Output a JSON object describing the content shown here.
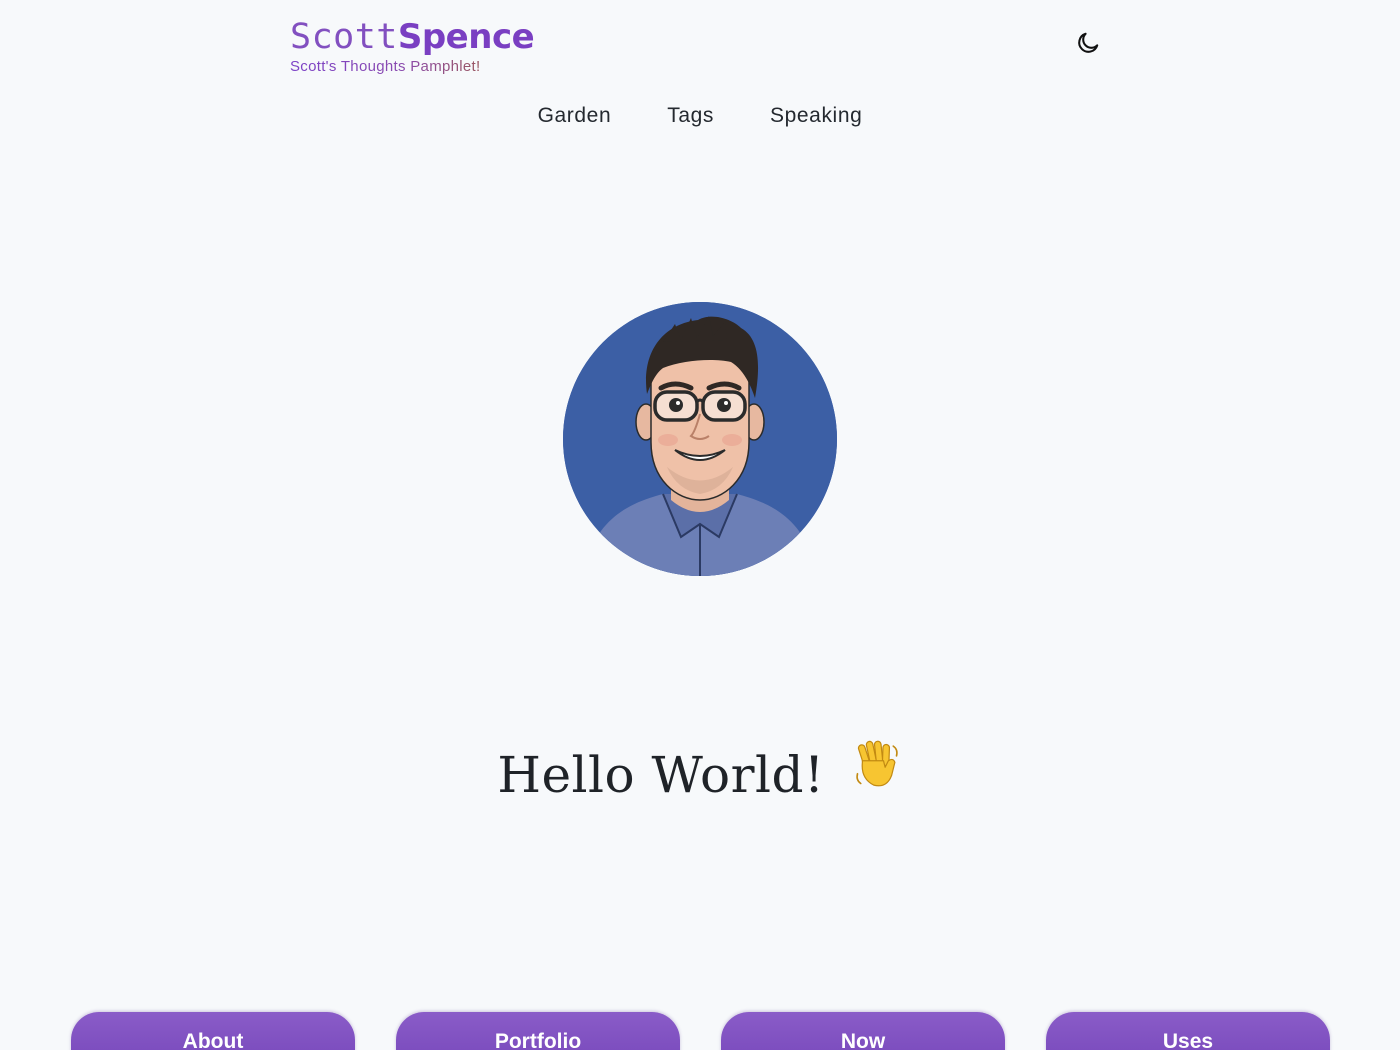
{
  "logo": {
    "first_name": "Scott",
    "last_name": "Spence",
    "tagline": "Scott's Thoughts Pamphlet!"
  },
  "theme_toggle": {
    "icon": "moon-icon"
  },
  "nav": {
    "items": [
      {
        "label": "Garden"
      },
      {
        "label": "Tags"
      },
      {
        "label": "Speaking"
      }
    ]
  },
  "hero": {
    "avatar_icon": "avatar-illustration",
    "title": "Hello World!",
    "emoji_icon": "waving-hand-icon"
  },
  "cards": [
    {
      "label": "About"
    },
    {
      "label": "Portfolio"
    },
    {
      "label": "Now"
    },
    {
      "label": "Uses"
    }
  ],
  "colors": {
    "background": "#f7f9fb",
    "brand_purple": "#7a3fc2",
    "tagline_end": "#a55d2b",
    "button_gradient_top": "#8a5cc8",
    "button_gradient_bottom": "#6f3fb5",
    "avatar_background": "#3c5fa5"
  }
}
